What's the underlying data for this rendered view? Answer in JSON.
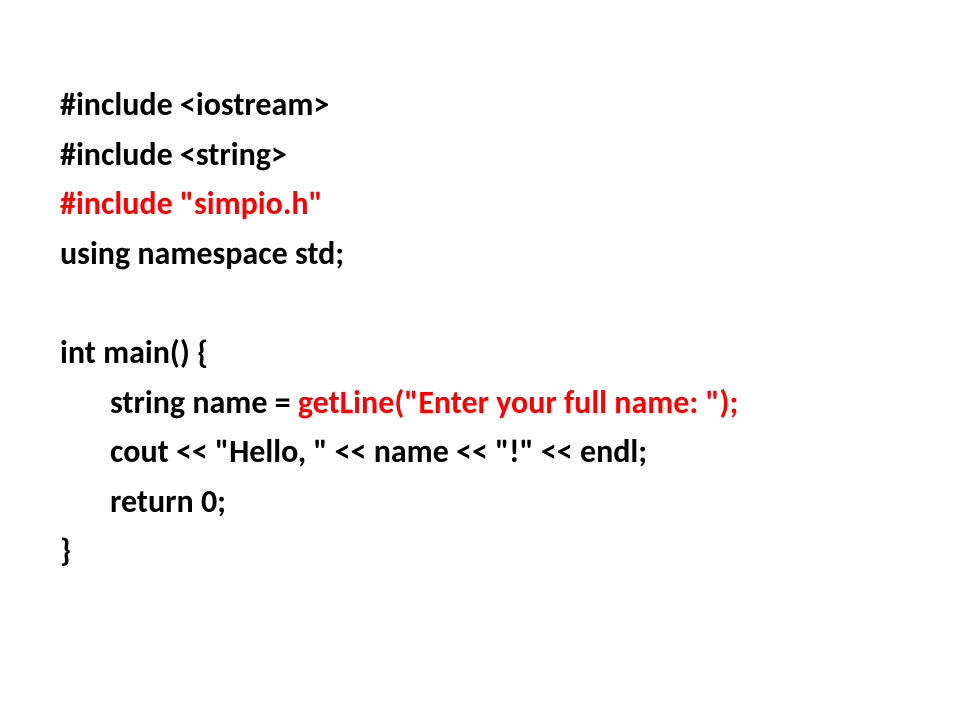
{
  "code": {
    "line1": "#include <iostream>",
    "line2": "#include <string>",
    "line3": "#include \"simpio.h\"",
    "line4": "using namespace std;",
    "line5": "int main() {",
    "line6_part1": "string name = ",
    "line6_part2": "getLine(\"Enter your full name: \");",
    "line7": "cout << \"Hello, \" << name << \"!\" << endl;",
    "line8": "return 0;",
    "line9": "}"
  }
}
